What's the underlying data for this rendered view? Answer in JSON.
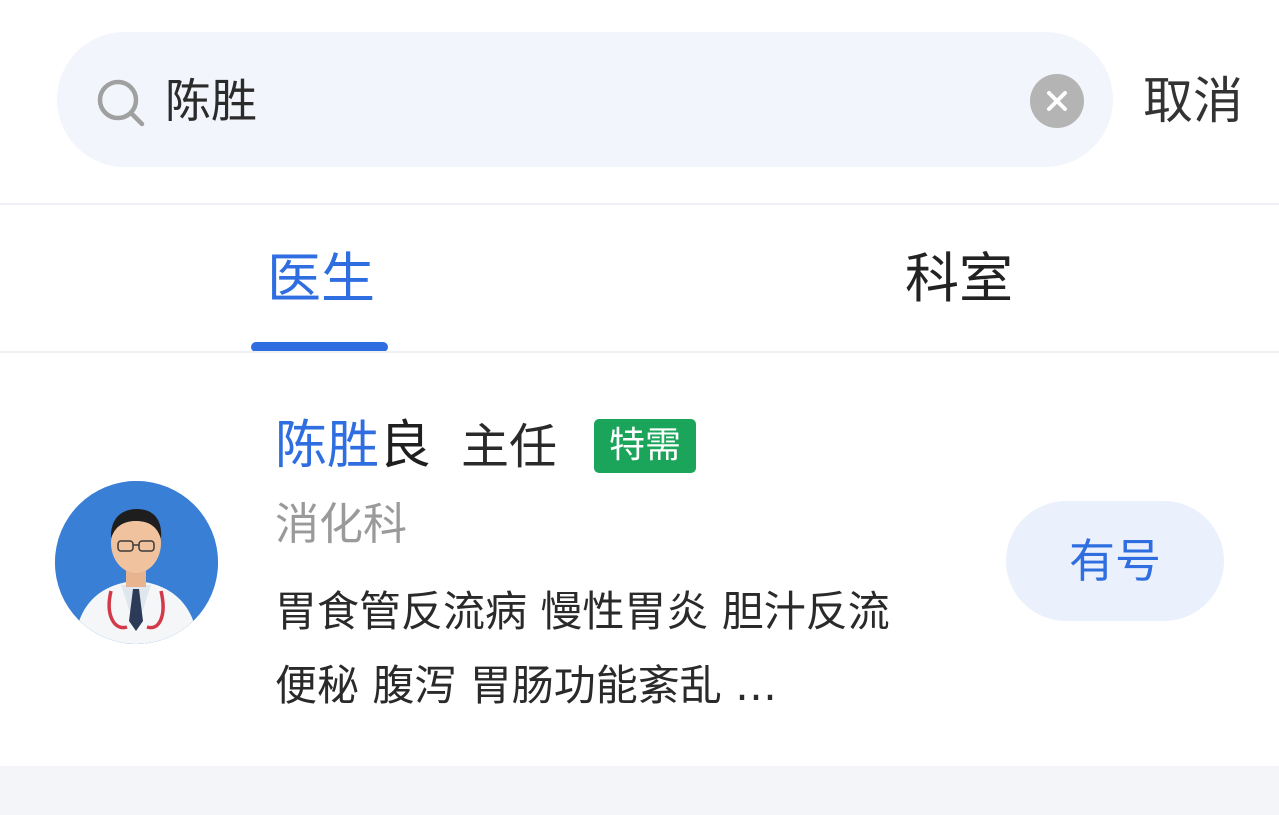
{
  "search": {
    "value": "陈胜",
    "cancel_label": "取消"
  },
  "tabs": [
    {
      "label": "医生",
      "active": true
    },
    {
      "label": "科室",
      "active": false
    }
  ],
  "results": [
    {
      "name_match": "陈胜",
      "name_rest": "良",
      "title": "主任",
      "tag": "特需",
      "department": "消化科",
      "specialty": "胃食管反流病 慢性胃炎 胆汁反流 便秘 腹泻 胃肠功能紊乱 …",
      "availability": "有号"
    }
  ],
  "colors": {
    "accent": "#2f6ee0",
    "tag_green": "#1aa55a",
    "search_bg": "#f2f5fb",
    "status_bg": "#eaf1fc"
  },
  "icons": {
    "search": "search-icon",
    "clear": "close-icon"
  }
}
